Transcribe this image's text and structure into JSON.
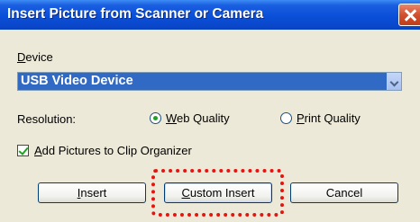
{
  "window": {
    "title": "Insert Picture from Scanner or Camera"
  },
  "device": {
    "label": "Device",
    "selected": "USB Video Device"
  },
  "resolution": {
    "label": "Resolution:",
    "options": [
      {
        "label": "Web Quality",
        "selected": true
      },
      {
        "label": "Print Quality",
        "selected": false
      }
    ]
  },
  "clip_organizer": {
    "label": "Add Pictures to Clip Organizer",
    "checked": true
  },
  "buttons": {
    "insert": "Insert",
    "custom_insert": "Custom Insert",
    "cancel": "Cancel"
  },
  "colors": {
    "title_bar": "#0a4fd8",
    "highlight": "#e8130f",
    "selection": "#316ac5"
  }
}
